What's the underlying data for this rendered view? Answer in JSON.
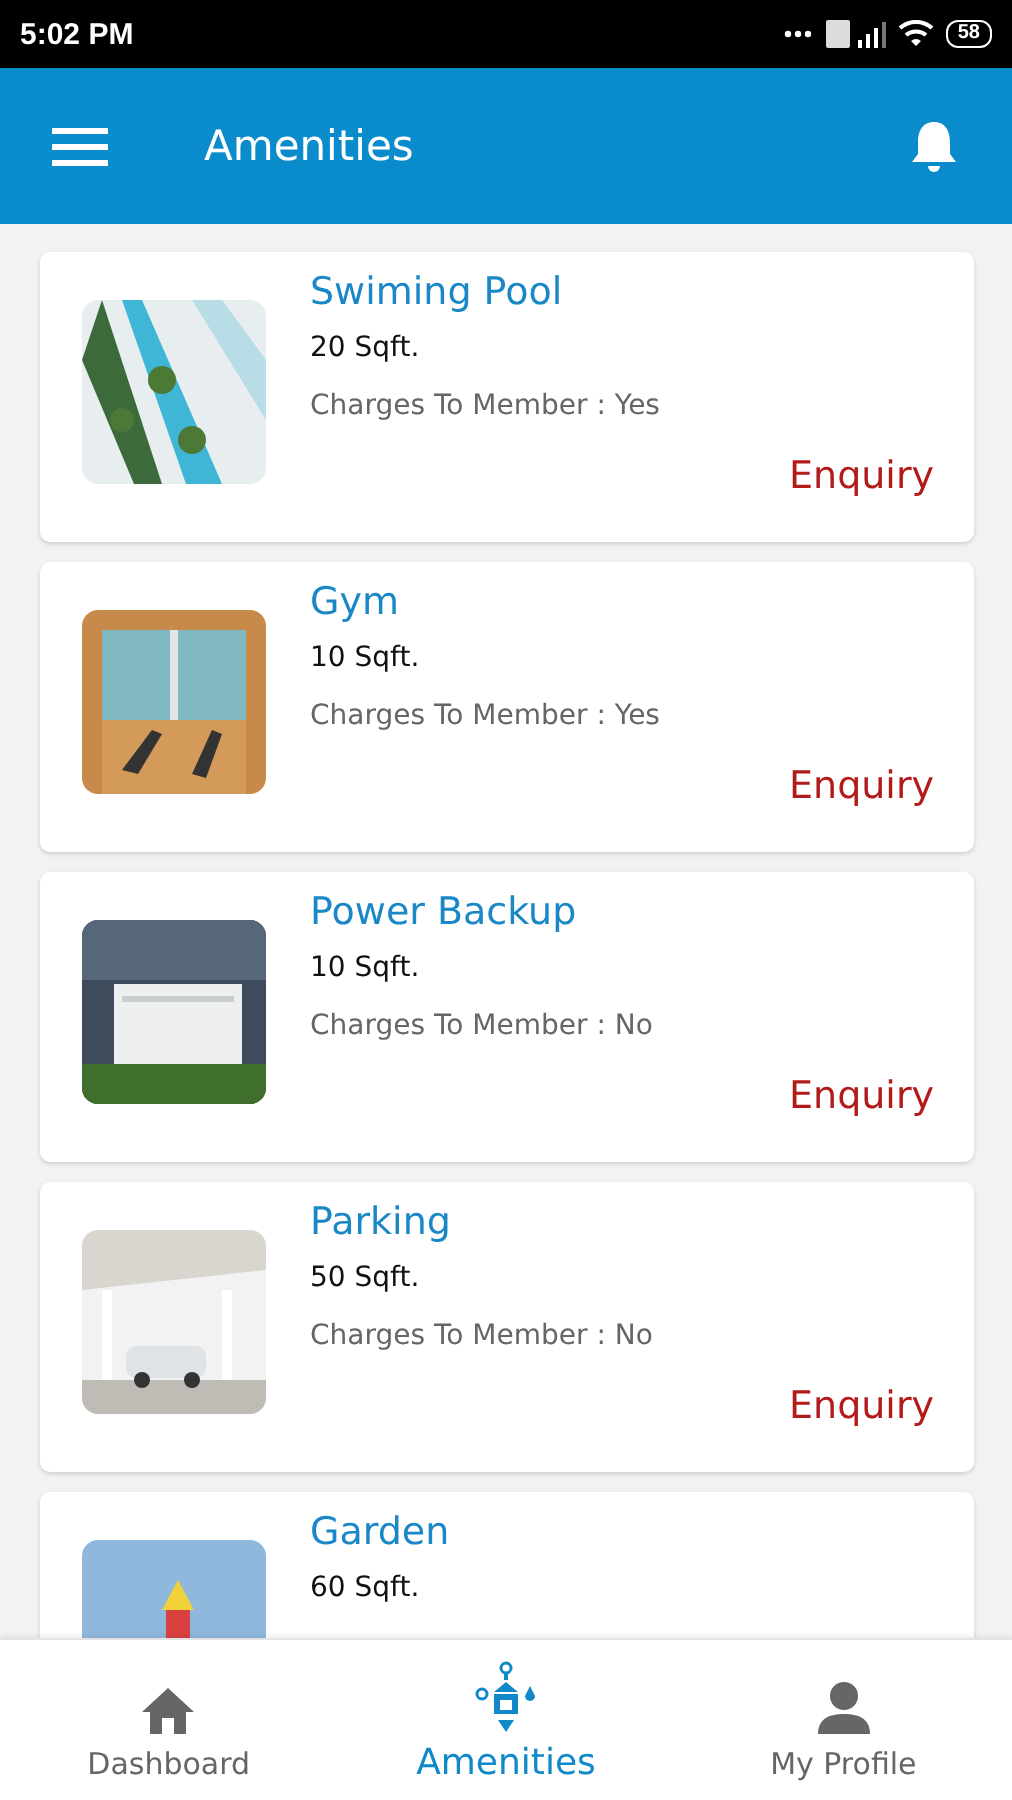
{
  "status_bar": {
    "time": "5:02 PM",
    "battery": "58"
  },
  "app_bar": {
    "title": "Amenities"
  },
  "amenities": [
    {
      "name": "Swiming Pool",
      "area": "20 Sqft.",
      "charges": "Charges To Member : Yes",
      "action": "Enquiry"
    },
    {
      "name": "Gym",
      "area": "10 Sqft.",
      "charges": "Charges To Member : Yes",
      "action": "Enquiry"
    },
    {
      "name": "Power Backup",
      "area": "10 Sqft.",
      "charges": "Charges To Member : No",
      "action": "Enquiry"
    },
    {
      "name": "Parking",
      "area": "50 Sqft.",
      "charges": "Charges To Member : No",
      "action": "Enquiry"
    },
    {
      "name": "Garden",
      "area": "60 Sqft."
    }
  ],
  "bottom_nav": [
    {
      "label": "Dashboard",
      "selected": false
    },
    {
      "label": "Amenities",
      "selected": true
    },
    {
      "label": "My Profile",
      "selected": false
    }
  ]
}
